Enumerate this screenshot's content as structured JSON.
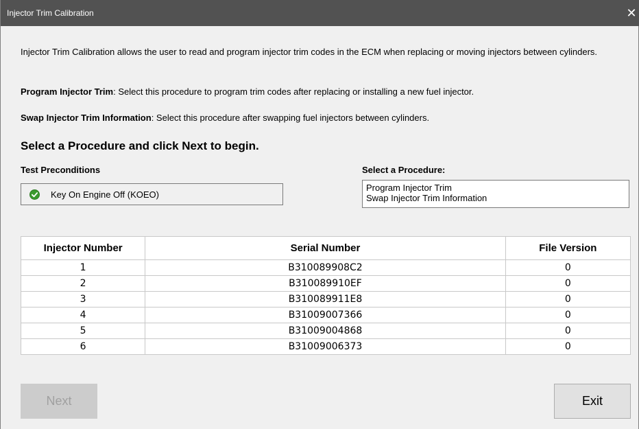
{
  "window": {
    "title": "Injector Trim Calibration",
    "close_glyph": "✕"
  },
  "intro": {
    "description": "Injector Trim Calibration allows the user to read and program injector trim codes in the ECM when replacing or moving injectors between cylinders.",
    "program": {
      "label": "Program Injector Trim",
      "text": ": Select this procedure to program trim codes after replacing or installing a new fuel injector."
    },
    "swap": {
      "label": "Swap Injector Trim Information",
      "text": ": Select this procedure after swapping fuel injectors between cylinders."
    },
    "heading": "Select a Procedure and click Next to begin."
  },
  "preconditions": {
    "label": "Test Preconditions",
    "item": "Key On Engine Off (KOEO)",
    "status_icon": "check-circle-icon",
    "status_color": "#3a9a2e"
  },
  "procedure": {
    "label": "Select a Procedure:",
    "options": [
      "Program Injector Trim",
      "Swap Injector Trim Information"
    ]
  },
  "table": {
    "headers": [
      "Injector Number",
      "Serial Number",
      "File Version"
    ],
    "rows": [
      [
        "1",
        "B310089908C2",
        "0"
      ],
      [
        "2",
        "B310089910EF",
        "0"
      ],
      [
        "3",
        "B310089911E8",
        "0"
      ],
      [
        "4",
        "B31009007366",
        "0"
      ],
      [
        "5",
        "B31009004868",
        "0"
      ],
      [
        "6",
        "B31009006373",
        "0"
      ]
    ]
  },
  "buttons": {
    "next": "Next",
    "exit": "Exit"
  }
}
